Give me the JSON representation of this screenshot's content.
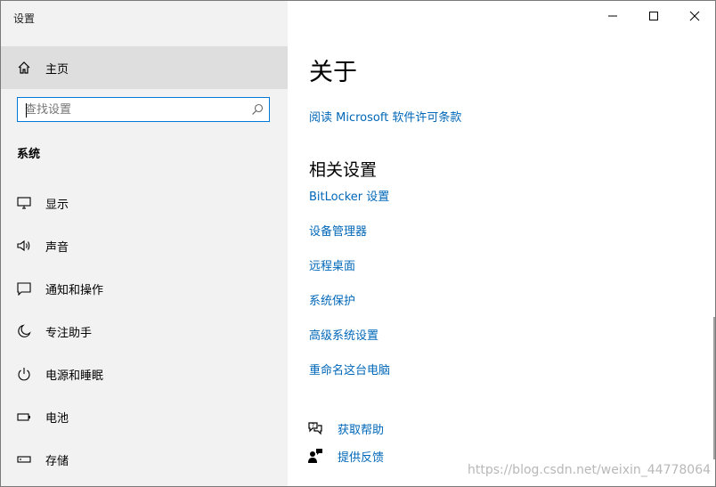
{
  "window": {
    "title": "设置",
    "controls": [
      "minimize-icon",
      "maximize-icon",
      "close-icon"
    ]
  },
  "sidebar": {
    "home_label": "主页",
    "search_placeholder": "查找设置",
    "section_header": "系统",
    "items": [
      {
        "label": "显示",
        "icon": "display-icon"
      },
      {
        "label": "声音",
        "icon": "sound-icon"
      },
      {
        "label": "通知和操作",
        "icon": "notification-icon"
      },
      {
        "label": "专注助手",
        "icon": "moon-icon"
      },
      {
        "label": "电源和睡眠",
        "icon": "power-icon"
      },
      {
        "label": "电池",
        "icon": "battery-icon"
      },
      {
        "label": "存储",
        "icon": "storage-icon"
      }
    ]
  },
  "main": {
    "title": "关于",
    "license_link": "阅读 Microsoft 软件许可条款",
    "related_title": "相关设置",
    "related_links": [
      "BitLocker 设置",
      "设备管理器",
      "远程桌面",
      "系统保护",
      "高级系统设置",
      "重命名这台电脑"
    ],
    "help_links": [
      {
        "label": "获取帮助",
        "icon": "help-chat-icon"
      },
      {
        "label": "提供反馈",
        "icon": "feedback-icon"
      }
    ]
  },
  "watermark": "https://blog.csdn.net/weixin_44778064",
  "colors": {
    "accent": "#0078d7",
    "link": "#0067b8",
    "sidebar_bg": "#f2f2f2",
    "selected_bg": "#dedede"
  }
}
